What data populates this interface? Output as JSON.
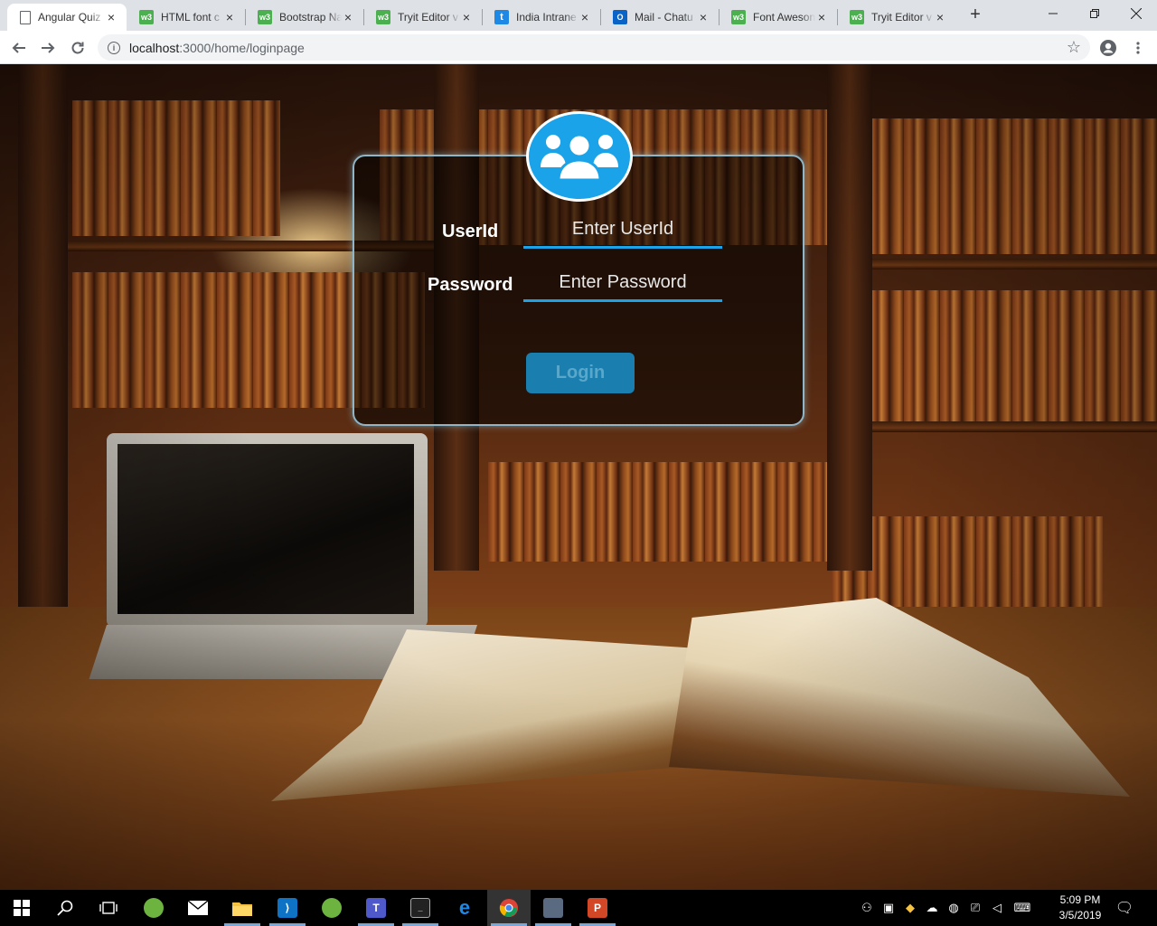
{
  "browser": {
    "tabs": [
      {
        "label": "Angular Quiz",
        "icon": "document-icon",
        "active": true
      },
      {
        "label": "HTML font c",
        "icon": "w3schools-icon"
      },
      {
        "label": "Bootstrap Na",
        "icon": "w3schools-icon"
      },
      {
        "label": "Tryit Editor v",
        "icon": "w3schools-icon"
      },
      {
        "label": "India Intrane",
        "icon": "t-icon"
      },
      {
        "label": "Mail - Chatu",
        "icon": "outlook-icon"
      },
      {
        "label": "Font Aweson",
        "icon": "w3schools-icon"
      },
      {
        "label": "Tryit Editor v",
        "icon": "w3schools-icon"
      }
    ],
    "url_host": "localhost",
    "url_path": ":3000/home/loginpage",
    "favicon_text": {
      "w3": "w3",
      "t": "t",
      "ol": "O"
    }
  },
  "login": {
    "userid_label": "UserId",
    "userid_placeholder": "Enter UserId",
    "password_label": "Password",
    "password_placeholder": "Enter Password",
    "login_button": "Login"
  },
  "taskbar": {
    "time": "5:09 PM",
    "date": "3/5/2019"
  },
  "colors": {
    "accent": "#1aa3e8",
    "button": "#1a7fae"
  }
}
